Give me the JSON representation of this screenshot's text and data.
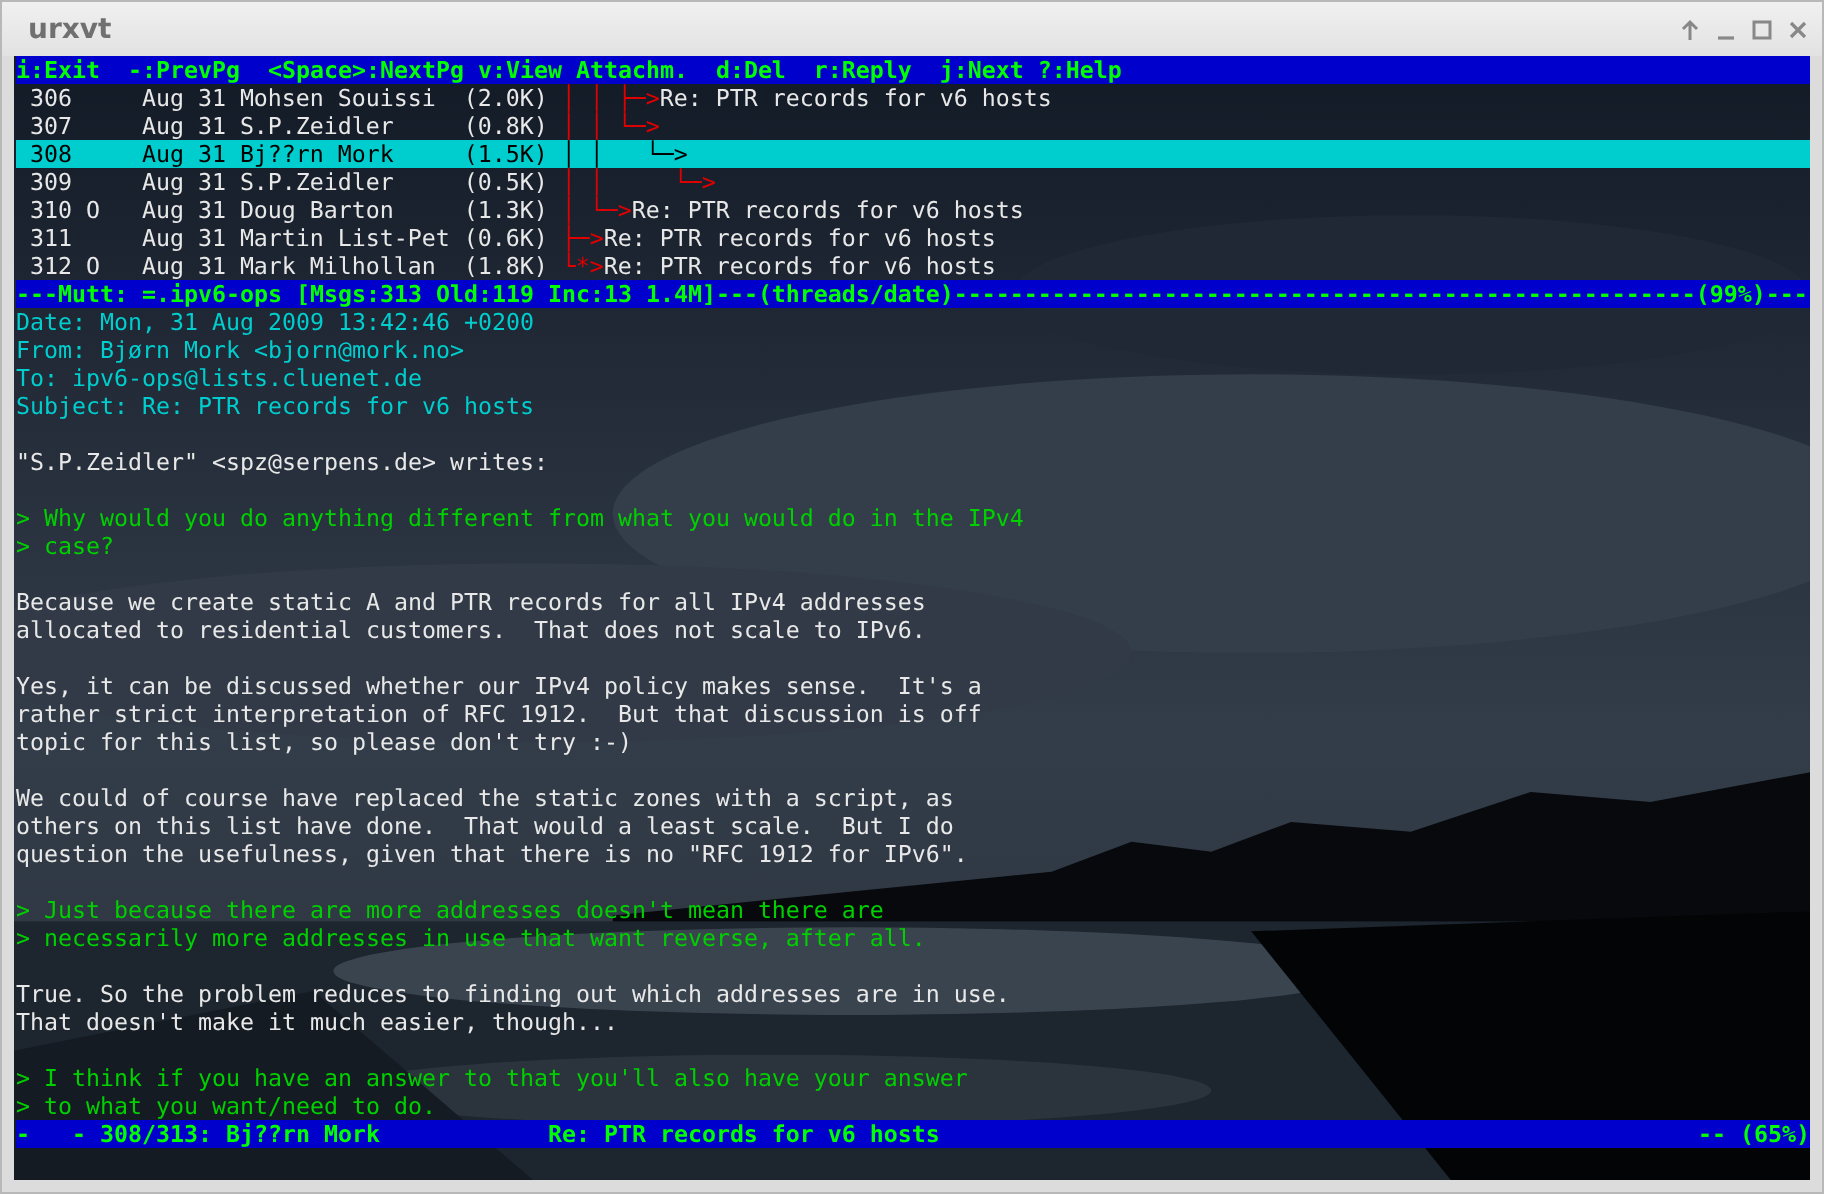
{
  "window": {
    "title": "urxvt"
  },
  "help_bar": "i:Exit  -:PrevPg  <Space>:NextPg v:View Attachm.  d:Del  r:Reply  j:Next ?:Help",
  "messages": [
    {
      "number": "306",
      "date": "Aug 31",
      "author": "Mohsen Souissi",
      "size": "(2.0K)",
      "tree": "│ │ ├─>",
      "subject": "Re: PTR records for v6 hosts",
      "selected": false
    },
    {
      "number": "307",
      "date": "Aug 31",
      "author": "S.P.Zeidler",
      "size": "(0.8K)",
      "tree": "│ │ └─>",
      "selected": false
    },
    {
      "number": "308",
      "date": "Aug 31",
      "author": "Bj??rn Mork",
      "size": "(1.5K)",
      "tree": "│ │   └─>",
      "selected": true
    },
    {
      "number": "309",
      "date": "Aug 31",
      "author": "S.P.Zeidler",
      "size": "(0.5K)",
      "tree": "│ │     └─>",
      "selected": false
    },
    {
      "number": "310",
      "flag": "O",
      "date": "Aug 31",
      "author": "Doug Barton",
      "size": "(1.3K)",
      "tree": "│ └─>",
      "subject": "Re: PTR records for v6 hosts",
      "selected": false
    },
    {
      "number": "311",
      "date": "Aug 31",
      "author": "Martin List-Pet",
      "size": "(0.6K)",
      "tree": "├─>",
      "subject": "Re: PTR records for v6 hosts",
      "selected": false
    },
    {
      "number": "312",
      "flag": "O",
      "date": "Aug 31",
      "author": "Mark Milhollan",
      "size": "(1.8K)",
      "tree": "└*>",
      "subject": "Re: PTR records for v6 hosts",
      "selected": false
    }
  ],
  "index_status": "---Mutt: =.ipv6-ops [Msgs:313 Old:119 Inc:13 1.4M]---(threads/date)-----------------------------------------------------(99%)---",
  "headers": [
    "Date: Mon, 31 Aug 2009 13:42:46 +0200",
    "From: Bjørn Mork <bjorn@mork.no>",
    "To: ipv6-ops@lists.cluenet.de",
    "Subject: Re: PTR records for v6 hosts"
  ],
  "body": [
    {
      "kind": "text",
      "lines": [
        "\"S.P.Zeidler\" <spz@serpens.de> writes:"
      ]
    },
    {
      "kind": "quote",
      "lines": [
        "> Why would you do anything different from what you would do in the IPv4",
        "> case?"
      ]
    },
    {
      "kind": "text",
      "lines": [
        "Because we create static A and PTR records for all IPv4 addresses",
        "allocated to residential customers.  That does not scale to IPv6."
      ]
    },
    {
      "kind": "text",
      "lines": [
        "Yes, it can be discussed whether our IPv4 policy makes sense.  It's a",
        "rather strict interpretation of RFC 1912.  But that discussion is off",
        "topic for this list, so please don't try :-)"
      ]
    },
    {
      "kind": "text",
      "lines": [
        "We could of course have replaced the static zones with a script, as",
        "others on this list have done.  That would a least scale.  But I do",
        "question the usefulness, given that there is no \"RFC 1912 for IPv6\"."
      ]
    },
    {
      "kind": "quote",
      "lines": [
        "> Just because there are more addresses doesn't mean there are",
        "> necessarily more addresses in use that want reverse, after all."
      ]
    },
    {
      "kind": "text",
      "lines": [
        "True. So the problem reduces to finding out which addresses are in use.",
        "That doesn't make it much easier, though..."
      ]
    },
    {
      "kind": "quote",
      "lines": [
        "> I think if you have an answer to that you'll also have your answer",
        "> to what you want/need to do."
      ]
    }
  ],
  "pager_status": {
    "position": "-   - 308/313: Bj??rn Mork",
    "subject": "Re: PTR records for v6 hosts",
    "progress": "-- (65%)"
  }
}
